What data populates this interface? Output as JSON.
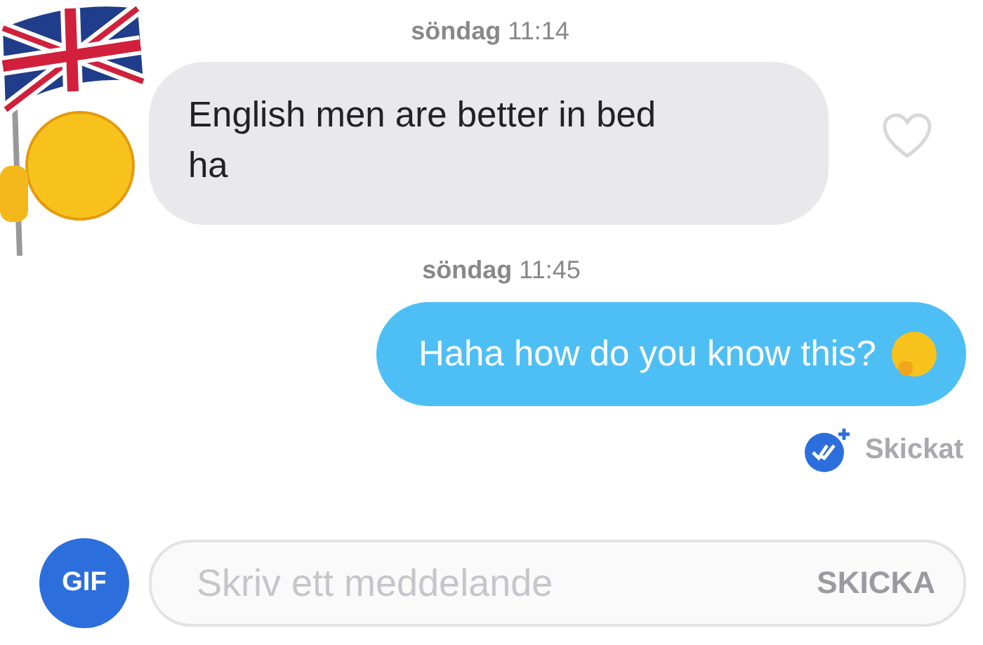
{
  "messages": [
    {
      "timestamp": "**söndag** 11:14",
      "kind": "received",
      "text": "English men are better in bed ha",
      "liked": false
    },
    {
      "timestamp": "**söndag** 11:45",
      "kind": "sent",
      "text": "Haha how do you know this?",
      "status": "Skickat"
    }
  ],
  "composer": {
    "gif_label": "GIF",
    "placeholder": "Skriv ett meddelande",
    "send_label": "SKICKA"
  }
}
